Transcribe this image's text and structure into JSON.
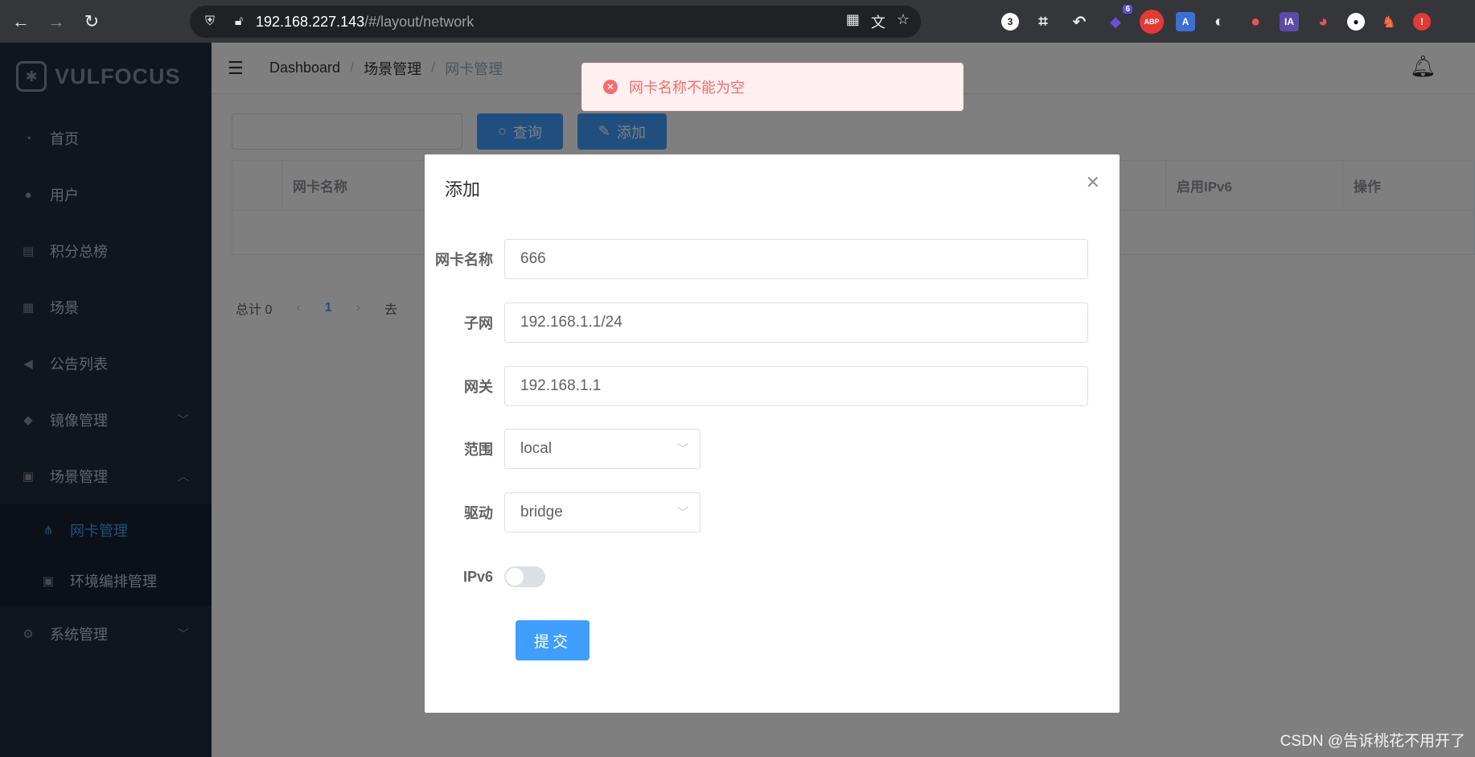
{
  "browser": {
    "url_host": "192.168.227.143",
    "url_path": "/#/layout/network",
    "ext_badge": "6",
    "ext_items": [
      "3",
      "⌗",
      "↶",
      "◆",
      "ABP",
      "A",
      "◐",
      "●",
      "IA",
      "◕",
      "●",
      "♞",
      "!"
    ]
  },
  "sidebar": {
    "logo_text": "VULFOCUS",
    "items": [
      {
        "label": "首页",
        "icon": "dashboard-icon"
      },
      {
        "label": "用户",
        "icon": "user-icon"
      },
      {
        "label": "积分总榜",
        "icon": "list-icon"
      },
      {
        "label": "场景",
        "icon": "grid-icon"
      },
      {
        "label": "公告列表",
        "icon": "megaphone-icon"
      },
      {
        "label": "镜像管理",
        "icon": "docker-icon"
      },
      {
        "label": "场景管理",
        "icon": "scene-icon"
      },
      {
        "label": "网卡管理",
        "icon": "network-icon"
      },
      {
        "label": "环境编排管理",
        "icon": "compose-icon"
      },
      {
        "label": "系统管理",
        "icon": "gear-icon"
      }
    ]
  },
  "breadcrumb": {
    "items": [
      "Dashboard",
      "场景管理",
      "网卡管理"
    ]
  },
  "toolbar": {
    "query_label": "查询",
    "add_label": "添加"
  },
  "table": {
    "columns": [
      "网卡名称",
      "启用IPv6",
      "操作"
    ]
  },
  "pagination": {
    "total": "总计 0",
    "page": "1",
    "goto": "去"
  },
  "modal": {
    "title": "添加",
    "fields": [
      {
        "label": "网卡名称",
        "value": "666"
      },
      {
        "label": "子网",
        "value": "192.168.1.1/24"
      },
      {
        "label": "网关",
        "value": "192.168.1.1"
      },
      {
        "label": "范围",
        "value": "local"
      },
      {
        "label": "驱动",
        "value": "bridge"
      },
      {
        "label": "IPv6",
        "value": "off"
      }
    ],
    "submit_label": "提交"
  },
  "toast": {
    "message": "网卡名称不能为空",
    "color": "#f56c6c"
  },
  "watermark": "CSDN @告诉桃花不用开了"
}
